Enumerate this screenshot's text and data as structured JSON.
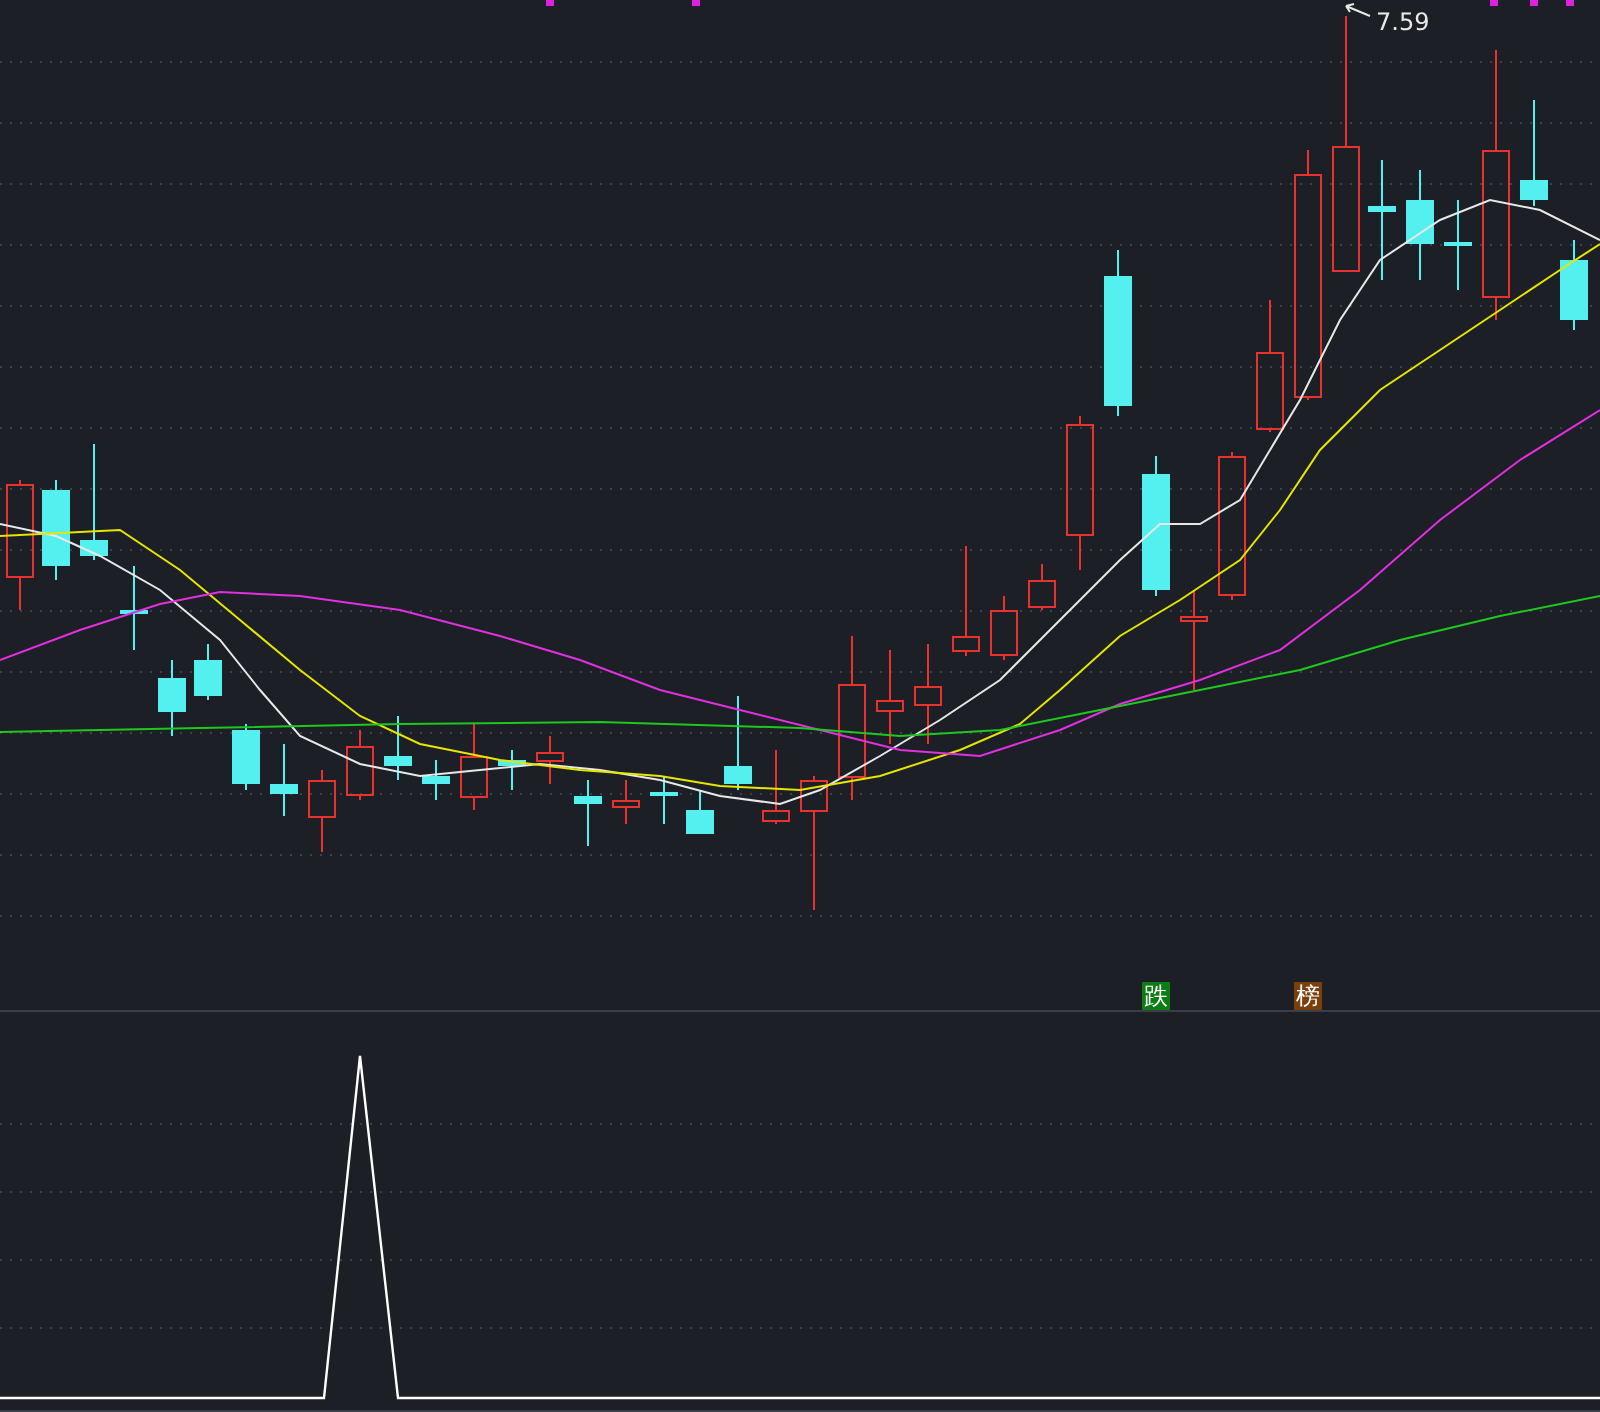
{
  "price_panel": {
    "high_label": "7.59",
    "markers": [
      {
        "text": "跌",
        "color": "#0b7d12"
      },
      {
        "text": "榜",
        "color": "#7b3f0c"
      }
    ]
  }
}
